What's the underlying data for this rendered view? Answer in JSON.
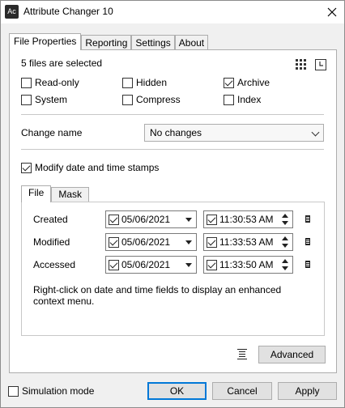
{
  "window": {
    "title": "Attribute Changer 10",
    "icon_text": "Ac"
  },
  "tabs": [
    {
      "label": "File Properties"
    },
    {
      "label": "Reporting"
    },
    {
      "label": "Settings"
    },
    {
      "label": "About"
    }
  ],
  "main": {
    "selection_text": "5 files are selected",
    "attributes": [
      {
        "label": "Read-only",
        "checked": false
      },
      {
        "label": "Hidden",
        "checked": false
      },
      {
        "label": "Archive",
        "checked": true
      },
      {
        "label": "System",
        "checked": false
      },
      {
        "label": "Compress",
        "checked": false
      },
      {
        "label": "Index",
        "checked": false
      }
    ],
    "change_name_label": "Change name",
    "change_name_value": "No changes",
    "modify_dates_label": "Modify date and time stamps",
    "modify_dates_checked": true
  },
  "subtabs": [
    {
      "label": "File"
    },
    {
      "label": "Mask"
    }
  ],
  "timestamps": [
    {
      "label": "Created",
      "date": "05/06/2021",
      "time": "11:30:53  AM"
    },
    {
      "label": "Modified",
      "date": "05/06/2021",
      "time": "11:33:53  AM"
    },
    {
      "label": "Accessed",
      "date": "05/06/2021",
      "time": "11:33:50  AM"
    }
  ],
  "hint_text": "Right-click on date and time fields to display an enhanced context menu.",
  "buttons": {
    "advanced": "Advanced",
    "ok": "OK",
    "cancel": "Cancel",
    "apply": "Apply"
  },
  "simulation_mode": {
    "label": "Simulation mode",
    "checked": false
  }
}
